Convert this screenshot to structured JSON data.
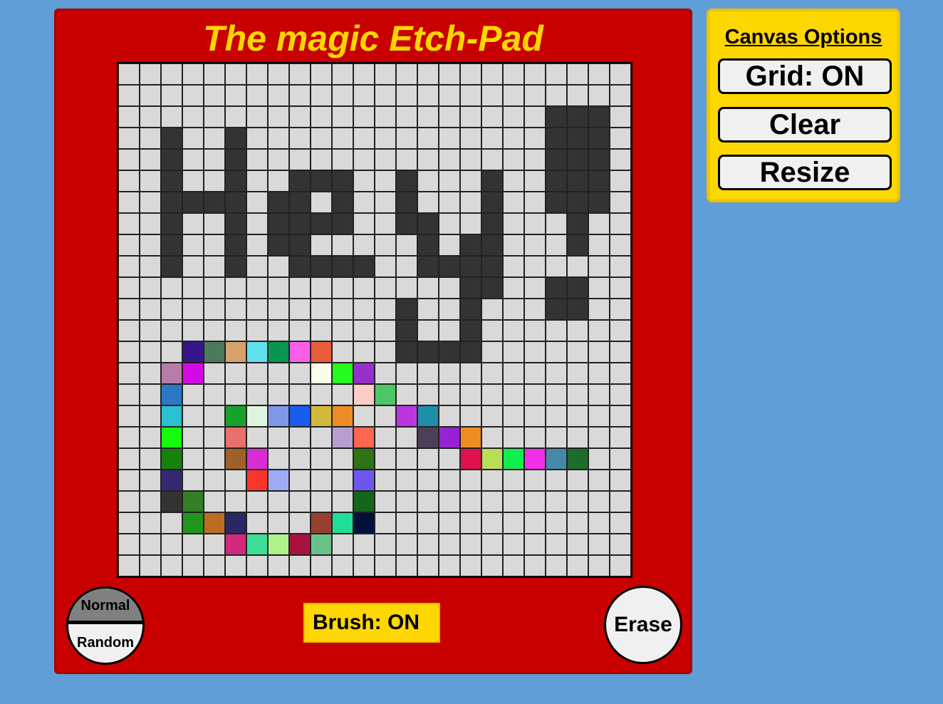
{
  "title": "The magic Etch-Pad",
  "canvas": {
    "size": 24,
    "default_color": "#d9d9d9",
    "painted": [
      [
        2,
        20,
        "#333333"
      ],
      [
        2,
        21,
        "#333333"
      ],
      [
        2,
        22,
        "#333333"
      ],
      [
        3,
        2,
        "#333333"
      ],
      [
        3,
        5,
        "#333333"
      ],
      [
        3,
        20,
        "#333333"
      ],
      [
        3,
        21,
        "#333333"
      ],
      [
        3,
        22,
        "#333333"
      ],
      [
        4,
        2,
        "#333333"
      ],
      [
        4,
        5,
        "#333333"
      ],
      [
        4,
        20,
        "#333333"
      ],
      [
        4,
        21,
        "#333333"
      ],
      [
        4,
        22,
        "#333333"
      ],
      [
        5,
        2,
        "#333333"
      ],
      [
        5,
        5,
        "#333333"
      ],
      [
        5,
        8,
        "#333333"
      ],
      [
        5,
        9,
        "#333333"
      ],
      [
        5,
        10,
        "#333333"
      ],
      [
        5,
        13,
        "#333333"
      ],
      [
        5,
        17,
        "#333333"
      ],
      [
        5,
        20,
        "#333333"
      ],
      [
        5,
        21,
        "#333333"
      ],
      [
        5,
        22,
        "#333333"
      ],
      [
        6,
        2,
        "#333333"
      ],
      [
        6,
        3,
        "#333333"
      ],
      [
        6,
        4,
        "#333333"
      ],
      [
        6,
        5,
        "#333333"
      ],
      [
        6,
        7,
        "#333333"
      ],
      [
        6,
        8,
        "#333333"
      ],
      [
        6,
        10,
        "#333333"
      ],
      [
        6,
        13,
        "#333333"
      ],
      [
        6,
        17,
        "#333333"
      ],
      [
        6,
        20,
        "#333333"
      ],
      [
        6,
        21,
        "#333333"
      ],
      [
        6,
        22,
        "#333333"
      ],
      [
        7,
        2,
        "#333333"
      ],
      [
        7,
        5,
        "#333333"
      ],
      [
        7,
        7,
        "#333333"
      ],
      [
        7,
        8,
        "#333333"
      ],
      [
        7,
        9,
        "#333333"
      ],
      [
        7,
        10,
        "#333333"
      ],
      [
        7,
        13,
        "#333333"
      ],
      [
        7,
        14,
        "#333333"
      ],
      [
        7,
        17,
        "#333333"
      ],
      [
        7,
        21,
        "#333333"
      ],
      [
        8,
        2,
        "#333333"
      ],
      [
        8,
        5,
        "#333333"
      ],
      [
        8,
        7,
        "#333333"
      ],
      [
        8,
        8,
        "#333333"
      ],
      [
        8,
        14,
        "#333333"
      ],
      [
        8,
        16,
        "#333333"
      ],
      [
        8,
        17,
        "#333333"
      ],
      [
        8,
        21,
        "#333333"
      ],
      [
        9,
        2,
        "#333333"
      ],
      [
        9,
        5,
        "#333333"
      ],
      [
        9,
        8,
        "#333333"
      ],
      [
        9,
        9,
        "#333333"
      ],
      [
        9,
        10,
        "#333333"
      ],
      [
        9,
        11,
        "#333333"
      ],
      [
        9,
        14,
        "#333333"
      ],
      [
        9,
        15,
        "#333333"
      ],
      [
        9,
        16,
        "#333333"
      ],
      [
        9,
        17,
        "#333333"
      ],
      [
        10,
        16,
        "#333333"
      ],
      [
        10,
        17,
        "#333333"
      ],
      [
        10,
        20,
        "#333333"
      ],
      [
        10,
        21,
        "#333333"
      ],
      [
        11,
        13,
        "#333333"
      ],
      [
        11,
        16,
        "#333333"
      ],
      [
        11,
        20,
        "#333333"
      ],
      [
        11,
        21,
        "#333333"
      ],
      [
        12,
        13,
        "#333333"
      ],
      [
        12,
        16,
        "#333333"
      ],
      [
        13,
        3,
        "#35148d"
      ],
      [
        13,
        4,
        "#4d7a5c"
      ],
      [
        13,
        5,
        "#d6a26e"
      ],
      [
        13,
        6,
        "#5ee1ec"
      ],
      [
        13,
        7,
        "#06964f"
      ],
      [
        13,
        8,
        "#fa5ee7"
      ],
      [
        13,
        9,
        "#e85c38"
      ],
      [
        13,
        13,
        "#333333"
      ],
      [
        13,
        14,
        "#333333"
      ],
      [
        13,
        15,
        "#333333"
      ],
      [
        13,
        16,
        "#333333"
      ],
      [
        14,
        2,
        "#b97ba8"
      ],
      [
        14,
        3,
        "#d40ae6"
      ],
      [
        14,
        9,
        "#fafee8"
      ],
      [
        14,
        10,
        "#26fa1e"
      ],
      [
        14,
        11,
        "#9730c9"
      ],
      [
        15,
        2,
        "#2b78c4"
      ],
      [
        15,
        11,
        "#fcccc6"
      ],
      [
        15,
        12,
        "#4ec567"
      ],
      [
        16,
        2,
        "#2ac0d1"
      ],
      [
        16,
        5,
        "#17a32b"
      ],
      [
        16,
        6,
        "#dff4de"
      ],
      [
        16,
        7,
        "#7e97e6"
      ],
      [
        16,
        8,
        "#1b5cf0"
      ],
      [
        16,
        9,
        "#d2b93b"
      ],
      [
        16,
        10,
        "#ec8c25"
      ],
      [
        16,
        13,
        "#bb36e0"
      ],
      [
        16,
        14,
        "#1f8ea8"
      ],
      [
        17,
        2,
        "#16fa0c"
      ],
      [
        17,
        5,
        "#e8706b"
      ],
      [
        17,
        10,
        "#b69fd0"
      ],
      [
        17,
        11,
        "#fd6653"
      ],
      [
        17,
        14,
        "#4e3f59"
      ],
      [
        17,
        15,
        "#9722d5"
      ],
      [
        17,
        16,
        "#ef8c24"
      ],
      [
        18,
        2,
        "#16820c"
      ],
      [
        18,
        5,
        "#a06129"
      ],
      [
        18,
        6,
        "#d92cd4"
      ],
      [
        18,
        11,
        "#2e7316"
      ],
      [
        18,
        16,
        "#e1114d"
      ],
      [
        18,
        17,
        "#b9dd57"
      ],
      [
        18,
        18,
        "#10ef4b"
      ],
      [
        18,
        19,
        "#f02fe8"
      ],
      [
        18,
        20,
        "#448aa8"
      ],
      [
        18,
        21,
        "#1e6c2b"
      ],
      [
        19,
        2,
        "#352873"
      ],
      [
        19,
        6,
        "#f8362b"
      ],
      [
        19,
        7,
        "#9cabf3"
      ],
      [
        19,
        11,
        "#6e57f0"
      ],
      [
        20,
        2,
        "#333333"
      ],
      [
        20,
        3,
        "#347e25"
      ],
      [
        20,
        11,
        "#156618"
      ],
      [
        21,
        3,
        "#21961d"
      ],
      [
        21,
        4,
        "#bd6c24"
      ],
      [
        21,
        5,
        "#2a2766"
      ],
      [
        21,
        9,
        "#98402f"
      ],
      [
        21,
        10,
        "#20dd97"
      ],
      [
        21,
        11,
        "#02113a"
      ],
      [
        22,
        5,
        "#d12a7c"
      ],
      [
        22,
        6,
        "#3ede99"
      ],
      [
        22,
        7,
        "#aef28a"
      ],
      [
        22,
        8,
        "#a9123f"
      ],
      [
        22,
        9,
        "#69c18a"
      ]
    ]
  },
  "controls": {
    "mode_normal": "Normal",
    "mode_random": "Random",
    "brush_label": "Brush: ON",
    "erase_label": "Erase"
  },
  "options": {
    "title": "Canvas Options",
    "grid_label": "Grid: ON",
    "clear_label": "Clear",
    "resize_label": "Resize"
  }
}
